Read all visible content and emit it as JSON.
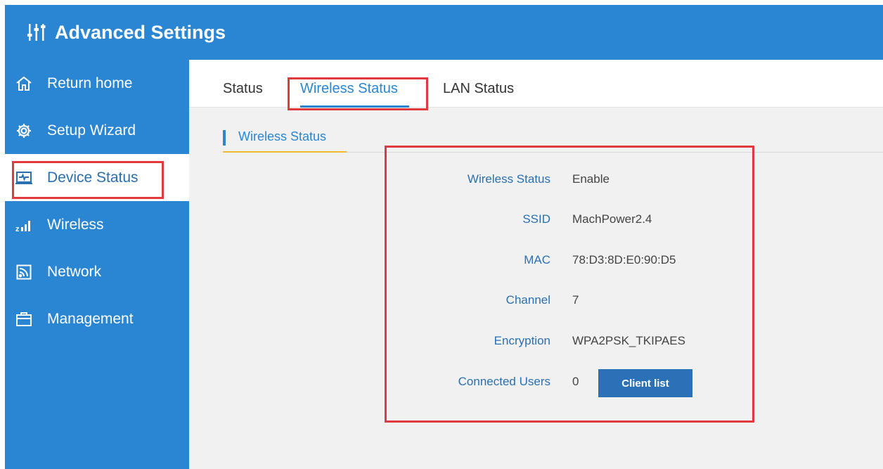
{
  "header": {
    "title": "Advanced Settings",
    "icon": "sliders-icon"
  },
  "sidebar": {
    "items": [
      {
        "label": "Return home",
        "icon": "home-icon"
      },
      {
        "label": "Setup Wizard",
        "icon": "gear-icon"
      },
      {
        "label": "Device Status",
        "icon": "monitor-icon",
        "active": true
      },
      {
        "label": "Wireless",
        "icon": "signal-icon"
      },
      {
        "label": "Network",
        "icon": "rss-icon"
      },
      {
        "label": "Management",
        "icon": "briefcase-icon"
      }
    ]
  },
  "tabs": [
    {
      "label": "Status"
    },
    {
      "label": "Wireless Status",
      "active": true
    },
    {
      "label": "LAN Status"
    }
  ],
  "section": {
    "title": "Wireless Status",
    "rows": [
      {
        "label": "Wireless Status",
        "value": "Enable"
      },
      {
        "label": "SSID",
        "value": "MachPower2.4"
      },
      {
        "label": "MAC",
        "value": "78:D3:8D:E0:90:D5"
      },
      {
        "label": "Channel",
        "value": "7"
      },
      {
        "label": "Encryption",
        "value": "WPA2PSK_TKIPAES"
      },
      {
        "label": "Connected Users",
        "value": "0"
      }
    ],
    "client_button": "Client list"
  },
  "colors": {
    "brand": "#2a86d2",
    "highlight": "#e03a3e",
    "accent_underline": "#f2b731"
  }
}
